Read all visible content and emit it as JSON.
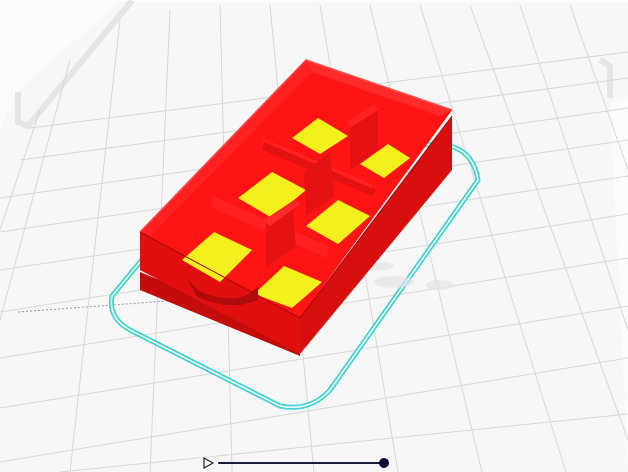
{
  "viewport": {
    "name": "slice-preview",
    "colors": {
      "background": "#fbfbfb",
      "grid": "#d8d8d8",
      "plate_edge": "#e9e9e9",
      "skirt": "#40d3d0",
      "wall": "#ff1414",
      "wall_dark": "#d80f0f",
      "wall_shadow": "#c40c0c",
      "infill": "#f3f01d"
    }
  },
  "model": {
    "name": "six-compartment-box",
    "compartments": 6
  },
  "layer_slider": {
    "progress": 1.0,
    "play_icon": "play-icon"
  }
}
